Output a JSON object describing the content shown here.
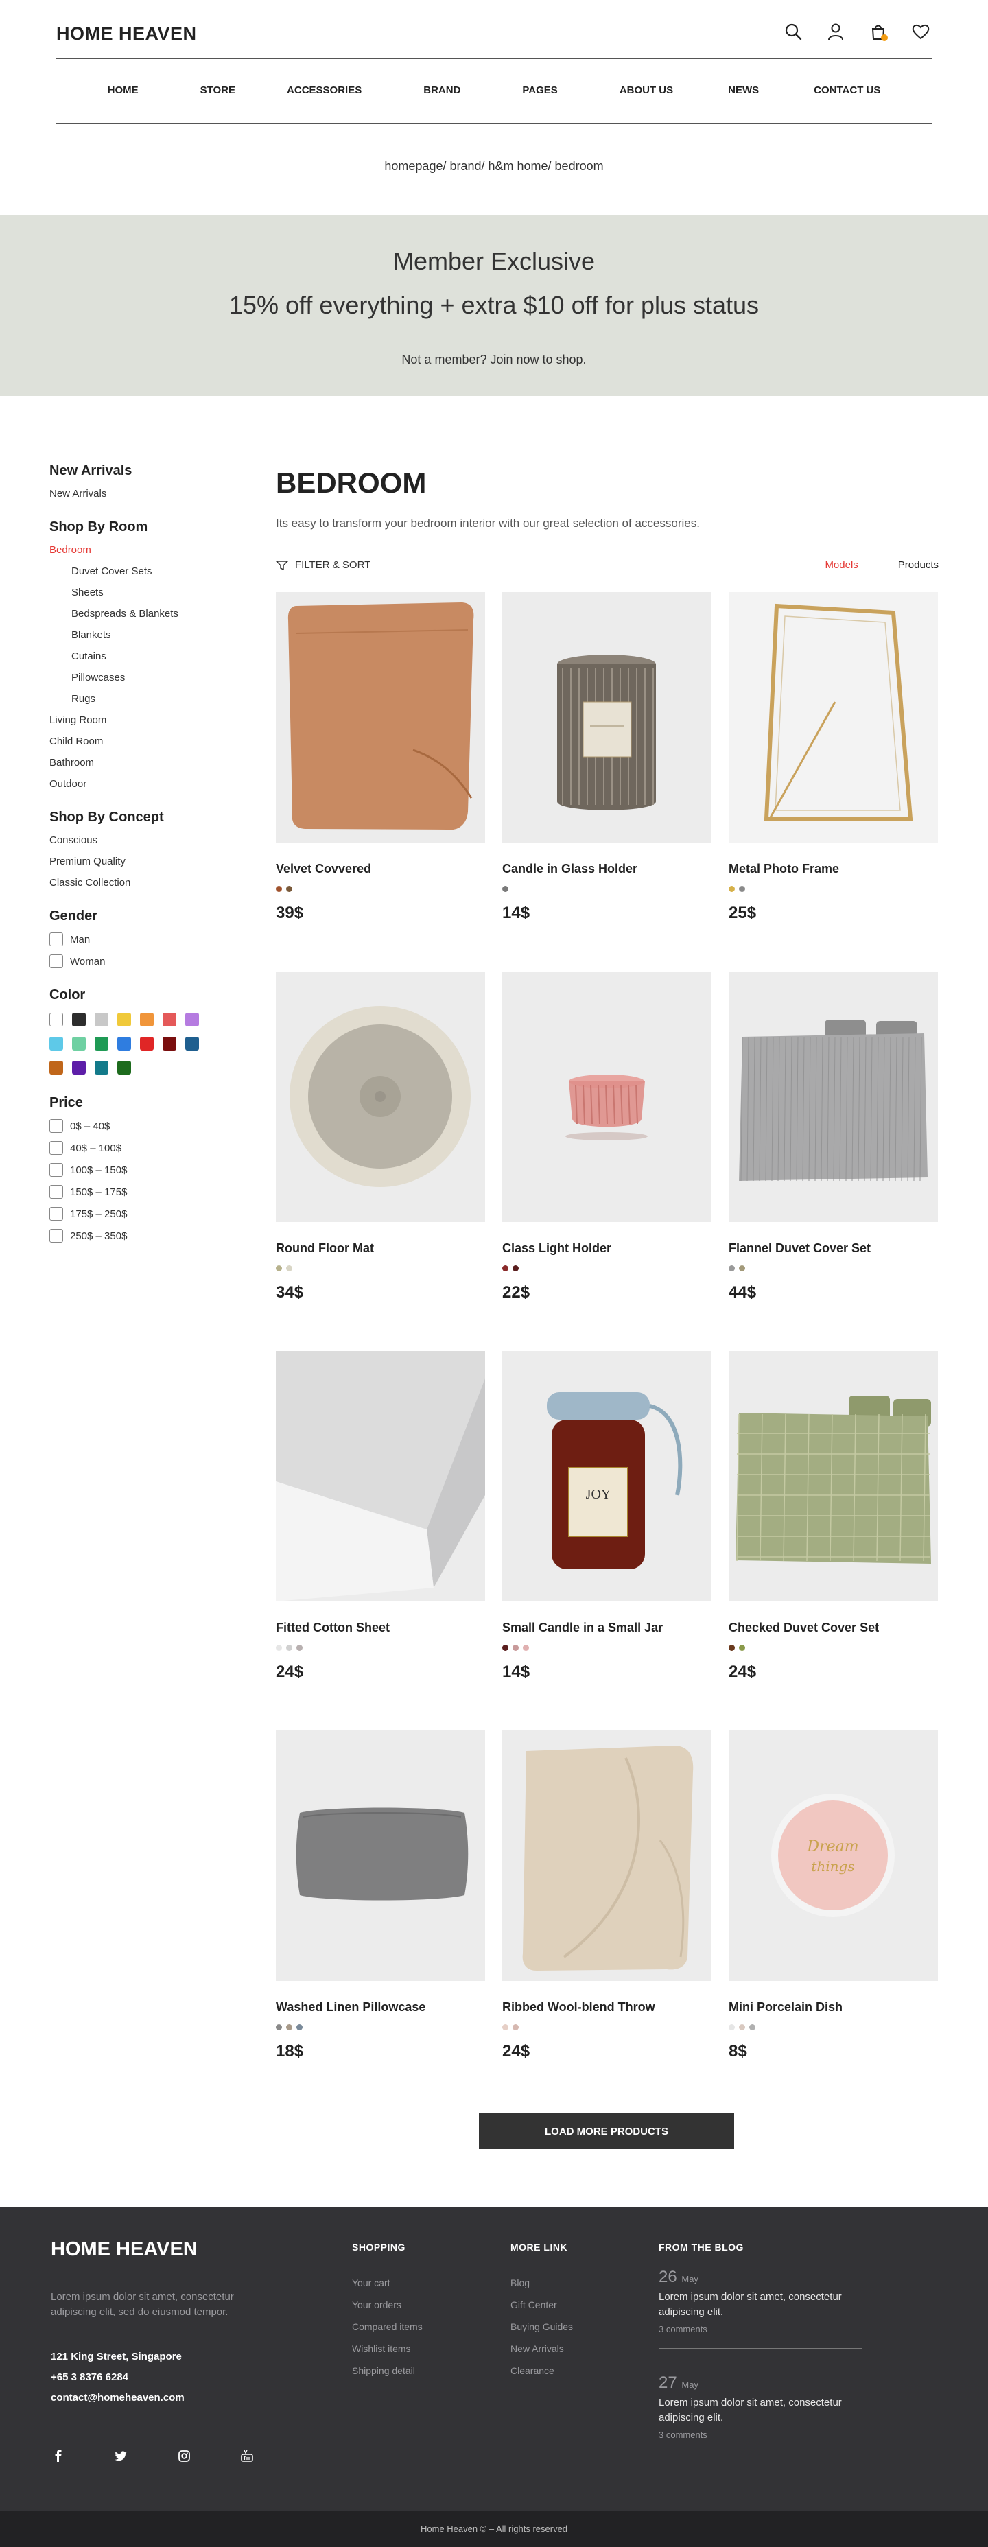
{
  "header": {
    "logo": "HOME HEAVEN",
    "icons": [
      "search-icon",
      "user-icon",
      "cart-icon",
      "heart-icon"
    ],
    "nav": [
      "HOME",
      "STORE",
      "ACCESSORIES",
      "BRAND",
      "PAGES",
      "ABOUT US",
      "NEWS",
      "CONTACT US"
    ],
    "breadcrumb": "homepage/ brand/ h&m home/ bedroom"
  },
  "banner": {
    "title": "Member Exclusive",
    "subtitle": "15% off everything + extra $10 off for plus status",
    "cta": "Not a member? Join now to shop."
  },
  "sidebar": {
    "new_arrivals": {
      "heading": "New Arrivals",
      "items": [
        "New Arrivals"
      ]
    },
    "by_room": {
      "heading": "Shop By Room",
      "active": "Bedroom",
      "sub_items": [
        "Duvet Cover Sets",
        "Sheets",
        "Bedspreads & Blankets",
        "Blankets",
        "Cutains",
        "Pillowcases",
        "Rugs"
      ],
      "items": [
        "Living Room",
        "Child Room",
        "Bathroom",
        "Outdoor"
      ]
    },
    "by_concept": {
      "heading": "Shop By Concept",
      "items": [
        "Conscious",
        "Premium Quality",
        "Classic Collection"
      ]
    },
    "gender": {
      "heading": "Gender",
      "options": [
        "Man",
        "Woman"
      ]
    },
    "color": {
      "heading": "Color",
      "swatches": [
        "#ffffff",
        "#2d2d2d",
        "#c8c8c8",
        "#f0c93a",
        "#f0953a",
        "#e45959",
        "#b57be0",
        "#5ec9e8",
        "#6fd0a2",
        "#1f9a55",
        "#2f7de0",
        "#e02626",
        "#7a0e0e",
        "#1f5f8f",
        "#c0661a",
        "#5d1ea8",
        "#137a8a",
        "#1d6b1d"
      ]
    },
    "price": {
      "heading": "Price",
      "options": [
        "0$ – 40$",
        "40$ – 100$",
        "100$ – 150$",
        "150$ – 175$",
        "175$ – 250$",
        "250$ – 350$"
      ]
    }
  },
  "main": {
    "title": "BEDROOM",
    "description": "Its easy to transform your bedroom interior with our great selection of accessories.",
    "filter_label": "FILTER & SORT",
    "view_models": "Models",
    "view_products": "Products",
    "load_more": "LOAD MORE PRODUCTS",
    "products": [
      {
        "name": "Velvet Covvered",
        "price": "39$",
        "colors": [
          "#a0522d",
          "#7a5a3a"
        ],
        "image": "blanket"
      },
      {
        "name": "Candle in Glass Holder",
        "price": "14$",
        "colors": [
          "#7a7a7a"
        ],
        "image": "candle-glass"
      },
      {
        "name": "Metal Photo Frame",
        "price": "25$",
        "colors": [
          "#d6b14a",
          "#8a8a8a"
        ],
        "image": "frame"
      },
      {
        "name": "Round Floor Mat",
        "price": "34$",
        "colors": [
          "#b7b28d",
          "#d9d6c6"
        ],
        "image": "mat"
      },
      {
        "name": "Class Light Holder",
        "price": "22$",
        "colors": [
          "#8a2a2a",
          "#5a1e1e"
        ],
        "image": "light-holder"
      },
      {
        "name": "Flannel Duvet Cover Set",
        "price": "44$",
        "colors": [
          "#9a9a9a",
          "#a39a7a"
        ],
        "image": "duvet-grey"
      },
      {
        "name": "Fitted Cotton Sheet",
        "price": "24$",
        "colors": [
          "#e6e6e6",
          "#d0d0d0",
          "#b8b0b0"
        ],
        "image": "sheet"
      },
      {
        "name": "Small Candle in a Small Jar",
        "price": "14$",
        "colors": [
          "#5a1e1e",
          "#c89a9a",
          "#e0b0b0"
        ],
        "image": "jar"
      },
      {
        "name": "Checked Duvet Cover Set",
        "price": "24$",
        "colors": [
          "#6a3a1e",
          "#8a9a4a"
        ],
        "image": "duvet-green"
      },
      {
        "name": "Washed Linen Pillowcase",
        "price": "18$",
        "colors": [
          "#8a8a8a",
          "#a89a8a",
          "#7a8a9a"
        ],
        "image": "pillow"
      },
      {
        "name": "Ribbed Wool-blend Throw",
        "price": "24$",
        "colors": [
          "#e6cfc6",
          "#d6b8b0"
        ],
        "image": "throw"
      },
      {
        "name": "Mini Porcelain Dish",
        "price": "8$",
        "colors": [
          "#e6e6e6",
          "#d9c9c0",
          "#b0b0b0"
        ],
        "image": "dish"
      }
    ]
  },
  "footer": {
    "logo": "HOME HEAVEN",
    "description": "Lorem ipsum dolor sit amet, consectetur adipiscing elit, sed do eiusmod tempor.",
    "address": "121 King Street, Singapore",
    "phone": "+65 3 8376 6284",
    "email": "contact@homeheaven.com",
    "social": [
      "facebook-icon",
      "twitter-icon",
      "instagram-icon",
      "youtube-icon"
    ],
    "shopping": {
      "heading": "SHOPPING",
      "links": [
        "Your cart",
        "Your orders",
        "Compared items",
        "Wishlist items",
        "Shipping detail"
      ]
    },
    "more": {
      "heading": "MORE LINK",
      "links": [
        "Blog",
        "Gift Center",
        "Buying Guides",
        "New Arrivals",
        "Clearance"
      ]
    },
    "blog": {
      "heading": "FROM THE BLOG",
      "posts": [
        {
          "day": "26",
          "month": "May",
          "text": "Lorem ipsum dolor sit amet, consectetur adipiscing elit.",
          "comments": "3 comments"
        },
        {
          "day": "27",
          "month": "May",
          "text": "Lorem ipsum dolor sit amet, consectetur adipiscing elit.",
          "comments": "3 comments"
        }
      ]
    },
    "copyright": "Home Heaven © – All rights reserved"
  }
}
